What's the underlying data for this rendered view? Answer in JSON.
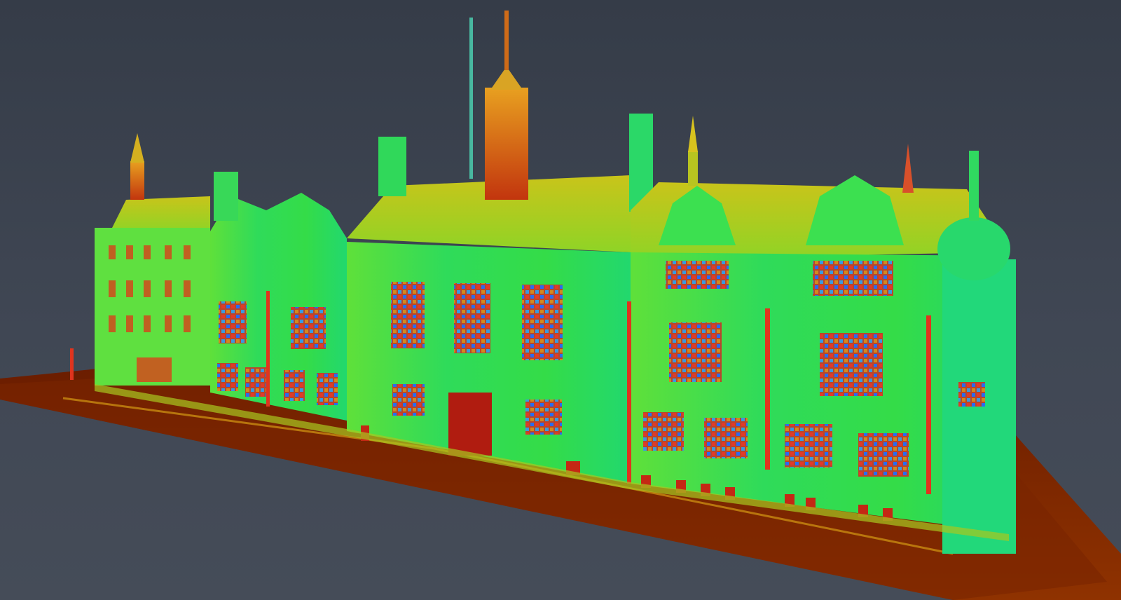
{
  "viewer": {
    "background_color": "#3f4653",
    "colormap": [
      "#7a0e00",
      "#b53a00",
      "#d9c400",
      "#9be31b",
      "#2fe040",
      "#18e08a"
    ],
    "ground_color": "#8a2a00",
    "facade_color": "#32e046",
    "roof_color": "#a8d21e",
    "tower_color": "#d24a12"
  },
  "scene": {
    "subject": "building-point-cloud"
  }
}
